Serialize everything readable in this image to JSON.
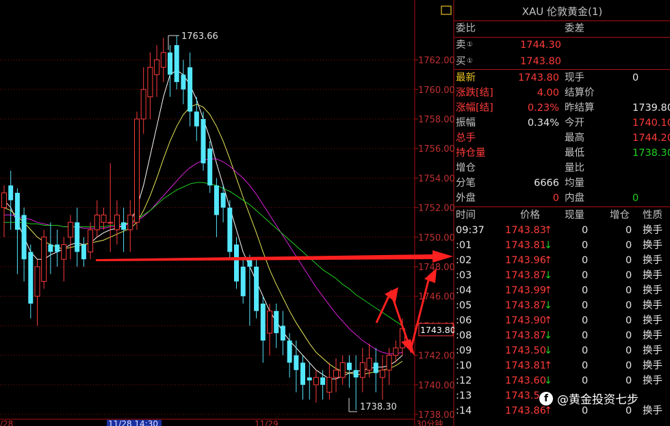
{
  "chart_data": {
    "type": "candlestick",
    "ylim": [
      1738.0,
      1763.5
    ],
    "y_ticks": [
      1738,
      1740,
      1742,
      1744,
      1746,
      1748,
      1750,
      1752,
      1754,
      1756,
      1758,
      1760,
      1762
    ],
    "y_tick_labels": [
      "1738.00",
      "1740.00",
      "1742.00",
      "1744.00",
      "1746.00",
      "1748.00",
      "1750.00",
      "1752.00",
      "1754.00",
      "1756.00",
      "1758.00",
      "1760.00",
      "1762.00"
    ],
    "x_labels": [
      "/28",
      "11/28 14:30",
      "11/29",
      "30分钟"
    ],
    "annotations": {
      "high": "1763.66",
      "low": "1738.30",
      "last_price": "1743.80"
    },
    "candles": [
      {
        "o": 1752.0,
        "h": 1753.5,
        "c": 1753.0,
        "l": 1750.0
      },
      {
        "o": 1753.5,
        "h": 1754.5,
        "c": 1752.5,
        "l": 1750.5
      },
      {
        "o": 1753.0,
        "h": 1753.3,
        "c": 1750.5,
        "l": 1747.5
      },
      {
        "o": 1751.5,
        "h": 1752.0,
        "c": 1748.5,
        "l": 1747.0
      },
      {
        "o": 1749.0,
        "h": 1749.5,
        "c": 1745.5,
        "l": 1744.5
      },
      {
        "o": 1746.0,
        "h": 1748.5,
        "c": 1748.0,
        "l": 1744.0
      },
      {
        "o": 1747.0,
        "h": 1750.5,
        "c": 1750.0,
        "l": 1746.5
      },
      {
        "o": 1749.5,
        "h": 1751.0,
        "c": 1749.0,
        "l": 1747.5
      },
      {
        "o": 1749.5,
        "h": 1750.5,
        "c": 1749.0,
        "l": 1748.0
      },
      {
        "o": 1748.5,
        "h": 1750.0,
        "c": 1749.5,
        "l": 1747.0
      },
      {
        "o": 1750.0,
        "h": 1751.5,
        "c": 1751.0,
        "l": 1748.5
      },
      {
        "o": 1751.0,
        "h": 1752.0,
        "c": 1749.0,
        "l": 1748.0
      },
      {
        "o": 1749.5,
        "h": 1750.0,
        "c": 1748.5,
        "l": 1748.0
      },
      {
        "o": 1749.0,
        "h": 1751.0,
        "c": 1750.5,
        "l": 1748.5
      },
      {
        "o": 1750.5,
        "h": 1752.5,
        "c": 1751.5,
        "l": 1750.0
      },
      {
        "o": 1751.0,
        "h": 1752.0,
        "c": 1751.5,
        "l": 1750.5
      },
      {
        "o": 1751.0,
        "h": 1755.0,
        "c": 1751.0,
        "l": 1749.0
      },
      {
        "o": 1750.5,
        "h": 1752.5,
        "c": 1751.5,
        "l": 1749.5
      },
      {
        "o": 1751.0,
        "h": 1752.0,
        "c": 1750.5,
        "l": 1749.0
      },
      {
        "o": 1750.5,
        "h": 1752.5,
        "c": 1751.5,
        "l": 1749.0
      },
      {
        "o": 1751.0,
        "h": 1758.5,
        "c": 1758.0,
        "l": 1750.5
      },
      {
        "o": 1758.0,
        "h": 1761.5,
        "c": 1760.0,
        "l": 1757.0
      },
      {
        "o": 1759.5,
        "h": 1762.5,
        "c": 1761.5,
        "l": 1758.0
      },
      {
        "o": 1761.0,
        "h": 1763.0,
        "c": 1762.0,
        "l": 1759.5
      },
      {
        "o": 1761.5,
        "h": 1763.5,
        "c": 1762.5,
        "l": 1760.5
      },
      {
        "o": 1762.5,
        "h": 1763.0,
        "c": 1761.0,
        "l": 1759.5
      },
      {
        "o": 1763.0,
        "h": 1763.66,
        "c": 1760.5,
        "l": 1760.0
      },
      {
        "o": 1761.0,
        "h": 1762.0,
        "c": 1760.0,
        "l": 1759.0
      },
      {
        "o": 1761.5,
        "h": 1762.5,
        "c": 1758.5,
        "l": 1757.5
      },
      {
        "o": 1758.5,
        "h": 1759.5,
        "c": 1757.5,
        "l": 1756.5
      },
      {
        "o": 1758.0,
        "h": 1758.5,
        "c": 1755.0,
        "l": 1754.5
      },
      {
        "o": 1756.0,
        "h": 1756.5,
        "c": 1753.5,
        "l": 1753.0
      },
      {
        "o": 1753.5,
        "h": 1754.0,
        "c": 1751.5,
        "l": 1750.0
      },
      {
        "o": 1753.0,
        "h": 1753.5,
        "c": 1752.0,
        "l": 1751.0
      },
      {
        "o": 1752.0,
        "h": 1752.5,
        "c": 1749.0,
        "l": 1748.5
      },
      {
        "o": 1749.5,
        "h": 1750.0,
        "c": 1747.0,
        "l": 1746.5
      },
      {
        "o": 1748.0,
        "h": 1748.5,
        "c": 1746.0,
        "l": 1745.5
      },
      {
        "o": 1748.5,
        "h": 1748.8,
        "c": 1748.0,
        "l": 1744.0
      },
      {
        "o": 1748.0,
        "h": 1748.5,
        "c": 1745.0,
        "l": 1744.5
      },
      {
        "o": 1745.5,
        "h": 1746.0,
        "c": 1743.0,
        "l": 1741.5
      },
      {
        "o": 1743.5,
        "h": 1745.5,
        "c": 1745.0,
        "l": 1742.0
      },
      {
        "o": 1745.0,
        "h": 1745.5,
        "c": 1743.5,
        "l": 1742.5
      },
      {
        "o": 1744.0,
        "h": 1745.0,
        "c": 1743.0,
        "l": 1742.0
      },
      {
        "o": 1743.0,
        "h": 1743.5,
        "c": 1741.5,
        "l": 1740.5
      },
      {
        "o": 1742.0,
        "h": 1743.0,
        "c": 1741.0,
        "l": 1739.5
      },
      {
        "o": 1741.5,
        "h": 1742.0,
        "c": 1740.0,
        "l": 1739.0
      },
      {
        "o": 1740.5,
        "h": 1741.5,
        "c": 1740.3,
        "l": 1739.0
      },
      {
        "o": 1740.0,
        "h": 1741.0,
        "c": 1740.5,
        "l": 1738.8
      },
      {
        "o": 1740.5,
        "h": 1741.0,
        "c": 1740.0,
        "l": 1739.0
      },
      {
        "o": 1739.5,
        "h": 1741.5,
        "c": 1740.5,
        "l": 1739.0
      },
      {
        "o": 1740.5,
        "h": 1741.8,
        "c": 1741.0,
        "l": 1739.5
      },
      {
        "o": 1740.5,
        "h": 1742.0,
        "c": 1741.5,
        "l": 1740.0
      },
      {
        "o": 1741.5,
        "h": 1742.0,
        "c": 1741.0,
        "l": 1739.8
      },
      {
        "o": 1741.0,
        "h": 1742.0,
        "c": 1740.5,
        "l": 1738.3
      },
      {
        "o": 1740.5,
        "h": 1742.5,
        "c": 1741.5,
        "l": 1739.5
      },
      {
        "o": 1741.0,
        "h": 1742.8,
        "c": 1741.8,
        "l": 1740.5
      },
      {
        "o": 1741.5,
        "h": 1742.5,
        "c": 1740.8,
        "l": 1739.5
      },
      {
        "o": 1740.5,
        "h": 1742.0,
        "c": 1741.0,
        "l": 1739.0
      },
      {
        "o": 1741.0,
        "h": 1742.5,
        "c": 1742.0,
        "l": 1740.0
      },
      {
        "o": 1742.0,
        "h": 1743.0,
        "c": 1742.5,
        "l": 1741.5
      },
      {
        "o": 1742.5,
        "h": 1744.5,
        "c": 1743.8,
        "l": 1742.0
      }
    ],
    "ma": [
      {
        "color": "#ffffff",
        "values": [
          1752.5,
          1752.0,
          1751.0,
          1750.0,
          1749.0,
          1748.5,
          1748.5,
          1748.8,
          1749.0,
          1749.2,
          1749.5,
          1749.6,
          1749.5,
          1749.6,
          1750.0,
          1750.3,
          1750.5,
          1750.6,
          1750.8,
          1751.0,
          1752.0,
          1753.5,
          1755.5,
          1757.5,
          1759.5,
          1761.0,
          1761.3,
          1761.0,
          1760.3,
          1759.3,
          1758.0,
          1756.7,
          1755.0,
          1753.5,
          1752.0,
          1750.5,
          1749.0,
          1748.0,
          1747.0,
          1746.0,
          1745.0,
          1744.3,
          1743.6,
          1743.0,
          1742.5,
          1742.0,
          1741.5,
          1741.0,
          1740.7,
          1740.4,
          1740.4,
          1740.6,
          1740.8,
          1740.9,
          1741.0,
          1741.1,
          1741.2,
          1741.2,
          1741.3,
          1741.6,
          1742.0
        ]
      },
      {
        "color": "#e8e858",
        "values": [
          1752.0,
          1751.8,
          1751.4,
          1751.0,
          1750.5,
          1750.0,
          1749.7,
          1749.5,
          1749.3,
          1749.2,
          1749.3,
          1749.4,
          1749.5,
          1749.6,
          1749.7,
          1749.8,
          1750.0,
          1750.2,
          1750.4,
          1750.6,
          1751.0,
          1751.8,
          1752.8,
          1754.0,
          1755.3,
          1756.5,
          1757.5,
          1758.3,
          1758.8,
          1759.0,
          1758.8,
          1758.3,
          1757.5,
          1756.5,
          1755.3,
          1754.0,
          1752.7,
          1751.5,
          1750.3,
          1749.0,
          1747.8,
          1746.8,
          1745.9,
          1745.0,
          1744.2,
          1743.5,
          1742.8,
          1742.2,
          1741.8,
          1741.4,
          1741.1,
          1740.9,
          1740.8,
          1740.7,
          1740.7,
          1740.8,
          1740.9,
          1741.0,
          1741.1,
          1741.3,
          1741.6
        ]
      },
      {
        "color": "#e020e0",
        "values": [
          1751.5,
          1751.5,
          1751.4,
          1751.3,
          1751.2,
          1751.0,
          1750.9,
          1750.8,
          1750.8,
          1750.7,
          1750.7,
          1750.7,
          1750.6,
          1750.6,
          1750.6,
          1750.6,
          1750.7,
          1750.7,
          1750.8,
          1750.9,
          1751.1,
          1751.4,
          1751.8,
          1752.3,
          1752.8,
          1753.3,
          1753.8,
          1754.3,
          1754.7,
          1755.0,
          1755.2,
          1755.3,
          1755.3,
          1755.1,
          1754.8,
          1754.4,
          1754.0,
          1753.5,
          1752.9,
          1752.2,
          1751.5,
          1750.8,
          1750.1,
          1749.4,
          1748.7,
          1748.0,
          1747.3,
          1746.6,
          1746.0,
          1745.4,
          1744.8,
          1744.3,
          1743.8,
          1743.4,
          1743.0,
          1742.7,
          1742.4,
          1742.2,
          1742.1,
          1742.1,
          1742.2
        ]
      },
      {
        "color": "#20d020",
        "values": [
          1751.0,
          1751.0,
          1751.0,
          1751.0,
          1750.9,
          1750.9,
          1750.8,
          1750.8,
          1750.8,
          1750.7,
          1750.7,
          1750.7,
          1750.7,
          1750.7,
          1750.7,
          1750.7,
          1750.8,
          1750.8,
          1750.9,
          1751.0,
          1751.2,
          1751.5,
          1751.8,
          1752.2,
          1752.6,
          1752.9,
          1753.2,
          1753.4,
          1753.6,
          1753.7,
          1753.7,
          1753.6,
          1753.5,
          1753.3,
          1753.1,
          1752.8,
          1752.5,
          1752.2,
          1751.8,
          1751.4,
          1751.0,
          1750.6,
          1750.2,
          1749.8,
          1749.4,
          1749.0,
          1748.6,
          1748.2,
          1747.8,
          1747.5,
          1747.2,
          1746.8,
          1746.5,
          1746.1,
          1745.8,
          1745.5,
          1745.2,
          1744.9,
          1744.6,
          1744.3,
          1744.0
        ]
      }
    ]
  },
  "panel": {
    "title": "XAU 伦敦黄金(1)",
    "wei_bi": "委比",
    "wei_cha": "委差",
    "sell_label": "卖",
    "sell_price": "1744.30",
    "buy_label": "买",
    "buy_price": "1743.80",
    "circle_mark": "①",
    "stats_left": [
      {
        "label": "最新",
        "value": "1743.80",
        "label_color": "yellow",
        "value_color": "red"
      },
      {
        "label": "涨跌[结]",
        "value": "4.00",
        "label_color": "red",
        "value_color": "red"
      },
      {
        "label": "涨幅[结]",
        "value": "0.23%",
        "label_color": "red",
        "value_color": "red"
      },
      {
        "label": "振幅",
        "value": "0.34%",
        "label_color": "lbl",
        "value_color": "white"
      },
      {
        "label": "总手",
        "value": "",
        "label_color": "red",
        "value_color": "white"
      },
      {
        "label": "持仓量",
        "value": "",
        "label_color": "red",
        "value_color": "white"
      },
      {
        "label": "增仓",
        "value": "",
        "label_color": "lbl",
        "value_color": "white"
      },
      {
        "label": "分笔",
        "value": "6666",
        "label_color": "lbl",
        "value_color": "white"
      },
      {
        "label": "外盘",
        "value": "0",
        "label_color": "lbl",
        "value_color": "red"
      }
    ],
    "stats_right": [
      {
        "label": "现手",
        "value": "0",
        "value_color": "white"
      },
      {
        "label": "结算价",
        "value": "",
        "value_color": "white"
      },
      {
        "label": "昨结算",
        "value": "1739.80",
        "value_color": "white"
      },
      {
        "label": "今开",
        "value": "1740.10",
        "value_color": "red"
      },
      {
        "label": "最高",
        "value": "1744.20",
        "value_color": "red"
      },
      {
        "label": "最低",
        "value": "1738.30",
        "value_color": "green"
      },
      {
        "label": "量比",
        "value": "",
        "value_color": "white"
      },
      {
        "label": "均量",
        "value": "",
        "value_color": "white"
      },
      {
        "label": "内盘",
        "value": "0",
        "value_color": "green"
      }
    ],
    "trade_headers": [
      "时间",
      "价格",
      "现量",
      "增仓",
      "性质"
    ],
    "trades": [
      {
        "time": "09:37",
        "price": "1743.83",
        "dir": "↑",
        "vol": "0",
        "inc": "0",
        "nature": "换手"
      },
      {
        "time": ":01",
        "price": "1743.81",
        "dir": "↓",
        "vol": "0",
        "inc": "0",
        "nature": "换手"
      },
      {
        "time": ":02",
        "price": "1743.96",
        "dir": "↑",
        "vol": "0",
        "inc": "0",
        "nature": "换手"
      },
      {
        "time": ":03",
        "price": "1743.87",
        "dir": "↓",
        "vol": "0",
        "inc": "0",
        "nature": "换手"
      },
      {
        "time": ":04",
        "price": "1743.99",
        "dir": "↑",
        "vol": "0",
        "inc": "0",
        "nature": "换手"
      },
      {
        "time": ":05",
        "price": "1743.87",
        "dir": "↓",
        "vol": "0",
        "inc": "0",
        "nature": "换手"
      },
      {
        "time": ":06",
        "price": "1743.90",
        "dir": "↑",
        "vol": "0",
        "inc": "0",
        "nature": "换手"
      },
      {
        "time": ":08",
        "price": "1743.87",
        "dir": "↓",
        "vol": "0",
        "inc": "0",
        "nature": "换手"
      },
      {
        "time": ":09",
        "price": "1743.50",
        "dir": "↓",
        "vol": "0",
        "inc": "0",
        "nature": "换手"
      },
      {
        "time": ":10",
        "price": "1743.81",
        "dir": "↑",
        "vol": "0",
        "inc": "0",
        "nature": "换手"
      },
      {
        "time": ":12",
        "price": "1743.60",
        "dir": "↓",
        "vol": "0",
        "inc": "0",
        "nature": "换手"
      },
      {
        "time": ":13",
        "price": "1743.5",
        "dir": "",
        "vol": "",
        "inc": "",
        "nature": ""
      },
      {
        "time": ":14",
        "price": "1743.86",
        "dir": "↑",
        "vol": "0",
        "inc": "0",
        "nature": "换手"
      }
    ]
  },
  "watermark": {
    "text": "@黄金投资七步",
    "icon": "facebook-icon"
  }
}
